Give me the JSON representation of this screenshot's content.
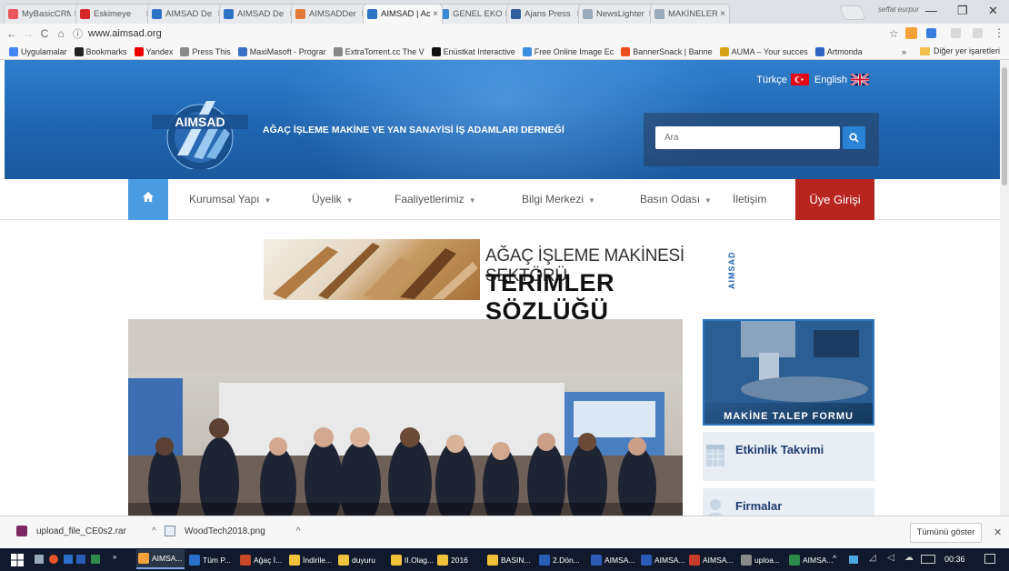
{
  "browser": {
    "tabs": [
      {
        "title": "MyBasicCRM",
        "color": "#e9585d"
      },
      {
        "title": "Eskimeye",
        "color": "#d4292b"
      },
      {
        "title": "AIMSAD De",
        "color": "#2d74c4"
      },
      {
        "title": "AIMSAD De",
        "color": "#2d74c4"
      },
      {
        "title": "AIMSADDer",
        "color": "#e07b3a"
      },
      {
        "title": "AIMSAD | Ac",
        "color": "#2d74c4"
      },
      {
        "title": "GENEL EKO",
        "color": "#3a8bd3"
      },
      {
        "title": "Ajans Press",
        "color": "#2f5f9e"
      },
      {
        "title": "NewsLighter",
        "color": "#9ab"
      },
      {
        "title": "MAKİNELER",
        "color": "#9ab"
      }
    ],
    "profile": "seffat eurpur",
    "url": "www.aimsad.org",
    "bookmarks": [
      {
        "label": "Uygulamalar",
        "icon": "apps-icon"
      },
      {
        "label": "Bookmarks",
        "icon": "star-icon"
      },
      {
        "label": "Yandex",
        "icon": "yandex-icon"
      },
      {
        "label": "Press This",
        "icon": "page-icon"
      },
      {
        "label": "MaxiMasoft - Prograr",
        "icon": "link-icon"
      },
      {
        "label": "ExtraTorrent.cc The V",
        "icon": "page-icon"
      },
      {
        "label": "Enüstkat Interactive",
        "icon": "e-icon"
      },
      {
        "label": "Free Online Image Ec",
        "icon": "image-icon"
      },
      {
        "label": "BannerSnack | Banne",
        "icon": "banner-icon"
      },
      {
        "label": "AUMA – Your succes",
        "icon": "auma-icon"
      },
      {
        "label": "Artmonda",
        "icon": "artmonda-icon"
      }
    ],
    "other_bookmarks": "Diğer yer işaretleri",
    "more": "»"
  },
  "site": {
    "logo_text": "AIMSAD",
    "tagline": "AĞAÇ İŞLEME MAKİNE VE YAN SANAYİSİ İŞ ADAMLARI DERNEĞİ",
    "lang_tr": "Türkçe",
    "lang_en": "English",
    "search_placeholder": "Ara",
    "nav": {
      "items": [
        "Kurumsal Yapı",
        "Üyelik",
        "Faaliyetlerimiz",
        "Bilgi Merkezi",
        "Basın Odası",
        "İletişim"
      ],
      "login": "Üye Girişi"
    },
    "banner": {
      "line1": "AĞAÇ İŞLEME MAKİNESİ SEKTÖRÜ",
      "line2": "TERİMLER SÖZLÜĞÜ",
      "vertical": "AIMSAD"
    },
    "side": {
      "makine": "MAKİNE TALEP FORMU",
      "etkinlik": "Etkinlik Takvimi",
      "firmalar": "Firmalar"
    }
  },
  "downloads": {
    "items": [
      "upload_file_CE0s2.rar",
      "WoodTech2018.png"
    ],
    "show_all": "Tümünü göster"
  },
  "taskbar": {
    "apps": [
      {
        "label": "AIMSA...",
        "color": "#f3a33a"
      },
      {
        "label": "Tüm P...",
        "color": "#2a6fc9"
      },
      {
        "label": "Ağaç İ...",
        "color": "#c9482a"
      },
      {
        "label": "İndirile...",
        "color": "#f0c23c"
      },
      {
        "label": "duyuru",
        "color": "#f0c23c"
      },
      {
        "label": "II.Olag...",
        "color": "#f0c23c"
      },
      {
        "label": "2016",
        "color": "#f0c23c"
      },
      {
        "label": "BASIN...",
        "color": "#f0c23c"
      },
      {
        "label": "2.Dön...",
        "color": "#2b5cb8"
      },
      {
        "label": "AIMSA...",
        "color": "#2b5cb8"
      },
      {
        "label": "AIMSA...",
        "color": "#2b5cb8"
      },
      {
        "label": "AIMSA...",
        "color": "#c93b2a"
      },
      {
        "label": "uploa...",
        "color": "#8a8a8a"
      },
      {
        "label": "AIMSA...",
        "color": "#2d8a4a"
      }
    ],
    "time": "00:36"
  }
}
